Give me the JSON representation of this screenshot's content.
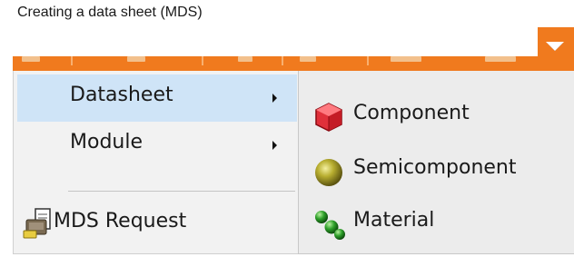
{
  "caption": "Creating a data sheet (MDS)",
  "main_menu": {
    "items": [
      {
        "label": "Datasheet",
        "has_submenu": true,
        "highlighted": true
      },
      {
        "label": "Module",
        "has_submenu": true,
        "highlighted": false
      },
      {
        "label": "MDS Request",
        "icon": "mds-request-icon",
        "has_submenu": false
      }
    ]
  },
  "sub_menu": {
    "items": [
      {
        "label": "Component",
        "icon": "component-cube-icon"
      },
      {
        "label": "Semicomponent",
        "icon": "semicomponent-sphere-icon"
      },
      {
        "label": "Material",
        "icon": "material-molecule-icon"
      }
    ]
  },
  "colors": {
    "toolbar": "#f07a1e",
    "menu_highlight": "#cfe4f7",
    "menu_background": "#f2f2f2"
  }
}
